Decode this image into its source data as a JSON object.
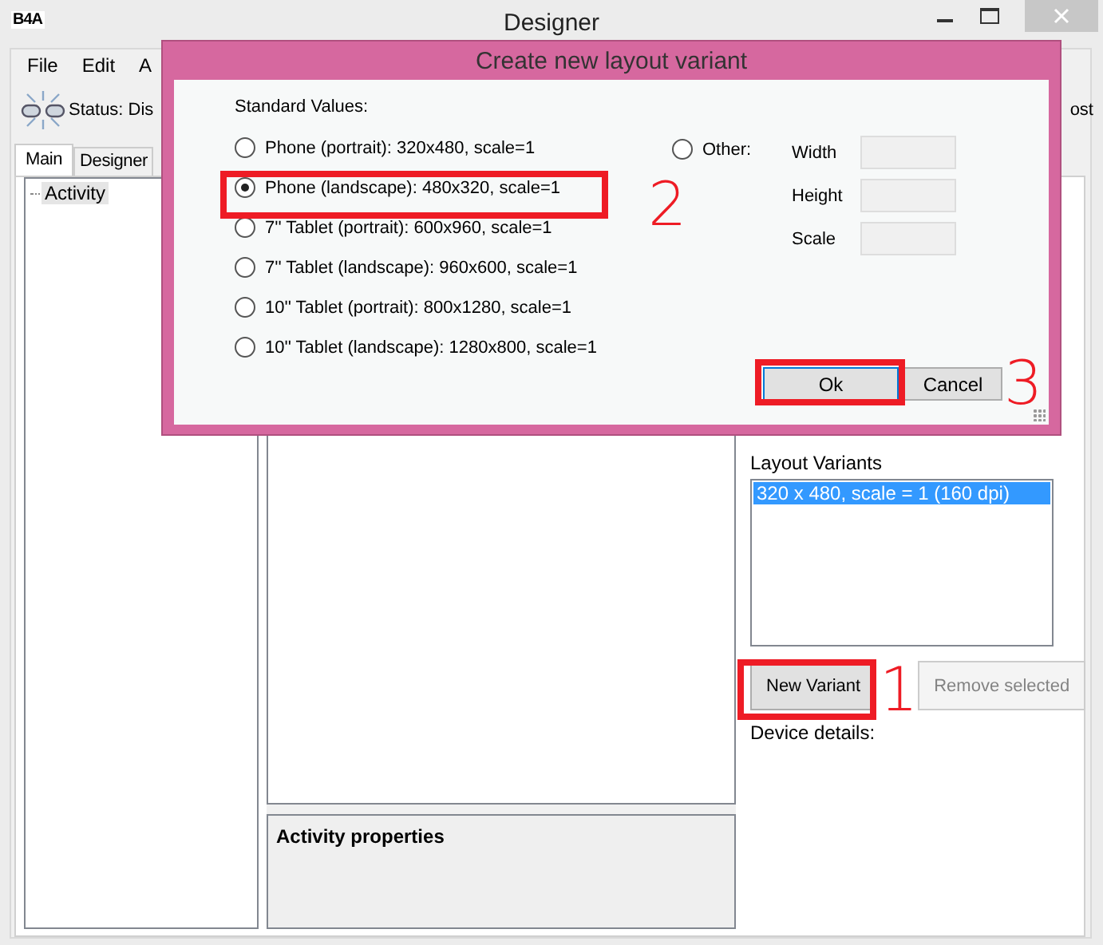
{
  "window": {
    "logo": "B4A",
    "title": "Designer"
  },
  "menu": [
    {
      "label": "File"
    },
    {
      "label": "Edit"
    },
    {
      "label": "A"
    }
  ],
  "toolbar": {
    "status": "Status: Dis",
    "right_text": "ost"
  },
  "tabs": [
    {
      "label": "Main",
      "selected": true
    },
    {
      "label": "Designer",
      "selected": false
    }
  ],
  "tree": [
    {
      "label": "Activity",
      "selected": true
    }
  ],
  "properties_panel": {
    "title": "Activity properties"
  },
  "layout_variants": {
    "label": "Layout Variants",
    "items": [
      {
        "label": "320 x 480, scale = 1 (160 dpi)",
        "selected": true
      }
    ],
    "buttons": [
      {
        "label": "New Variant",
        "disabled": false
      },
      {
        "label": "Remove selected",
        "disabled": true
      }
    ],
    "device_details": "Device details:"
  },
  "dialog": {
    "title": "Create new layout variant",
    "group_label": "Standard Values:",
    "options": [
      {
        "label": "Phone (portrait): 320x480, scale=1",
        "selected": false
      },
      {
        "label": "Phone (landscape): 480x320, scale=1",
        "selected": true
      },
      {
        "label": "7'' Tablet (portrait): 600x960, scale=1",
        "selected": false
      },
      {
        "label": "7'' Tablet (landscape): 960x600, scale=1",
        "selected": false
      },
      {
        "label": "10'' Tablet (portrait): 800x1280, scale=1",
        "selected": false
      },
      {
        "label": "10'' Tablet (landscape): 1280x800, scale=1",
        "selected": false
      }
    ],
    "other": {
      "label": "Other:",
      "selected": false
    },
    "fields": [
      {
        "label": "Width"
      },
      {
        "label": "Height"
      },
      {
        "label": "Scale"
      }
    ],
    "buttons": [
      {
        "label": "Ok",
        "kind": "default"
      },
      {
        "label": "Cancel",
        "kind": "normal"
      }
    ]
  },
  "annotations": [
    {
      "number": "1"
    },
    {
      "number": "2"
    },
    {
      "number": "3"
    }
  ]
}
